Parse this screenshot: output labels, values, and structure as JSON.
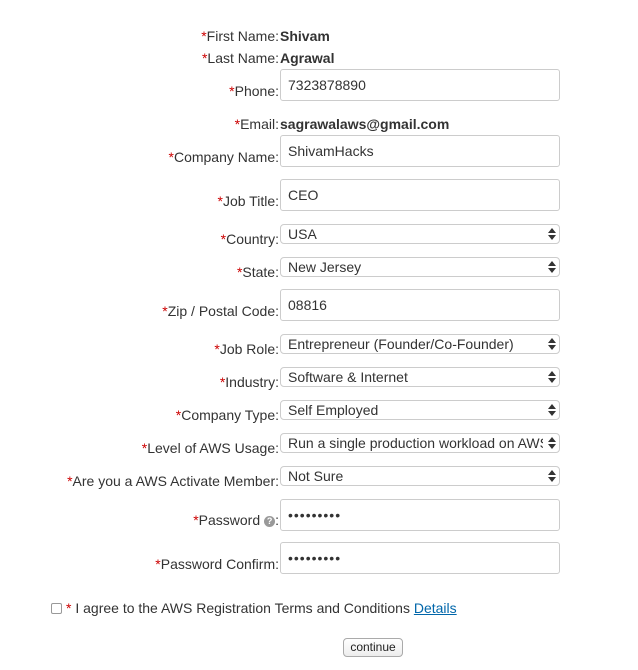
{
  "form": {
    "required_mark": "*",
    "first_name": {
      "label": "First Name:",
      "value": "Shivam"
    },
    "last_name": {
      "label": "Last Name:",
      "value": "Agrawal"
    },
    "phone": {
      "label": "Phone:",
      "value": "7323878890"
    },
    "email": {
      "label": "Email:",
      "value": "sagrawalaws@gmail.com"
    },
    "company_name": {
      "label": "Company Name:",
      "value": "ShivamHacks"
    },
    "job_title": {
      "label": "Job Title:",
      "value": "CEO"
    },
    "country": {
      "label": "Country:",
      "selected": "USA"
    },
    "state": {
      "label": "State:",
      "selected": "New Jersey"
    },
    "zip": {
      "label": "Zip / Postal Code:",
      "value": "08816"
    },
    "job_role": {
      "label": "Job Role:",
      "selected": "Entrepreneur (Founder/Co-Founder)"
    },
    "industry": {
      "label": "Industry:",
      "selected": "Software & Internet"
    },
    "company_type": {
      "label": "Company Type:",
      "selected": "Self Employed"
    },
    "aws_usage": {
      "label": "Level of AWS Usage:",
      "selected": "Run a single production workload on AWS"
    },
    "activate_member": {
      "label": "Are you a AWS Activate Member:",
      "selected": "Not Sure"
    },
    "password": {
      "label": "Password",
      "label_suffix": ":",
      "help_glyph": "?",
      "value": "•••••••••"
    },
    "password_confirm": {
      "label": "Password Confirm:",
      "value": "•••••••••"
    }
  },
  "terms": {
    "text": "I agree to the AWS Registration Terms and Conditions",
    "link": "Details"
  },
  "submit_label": "continue",
  "colors": {
    "required": "#cc0000",
    "link": "#0066aa"
  },
  "icons": {
    "select_arrow": "updown-arrows-icon",
    "help": "question-circle-icon"
  }
}
